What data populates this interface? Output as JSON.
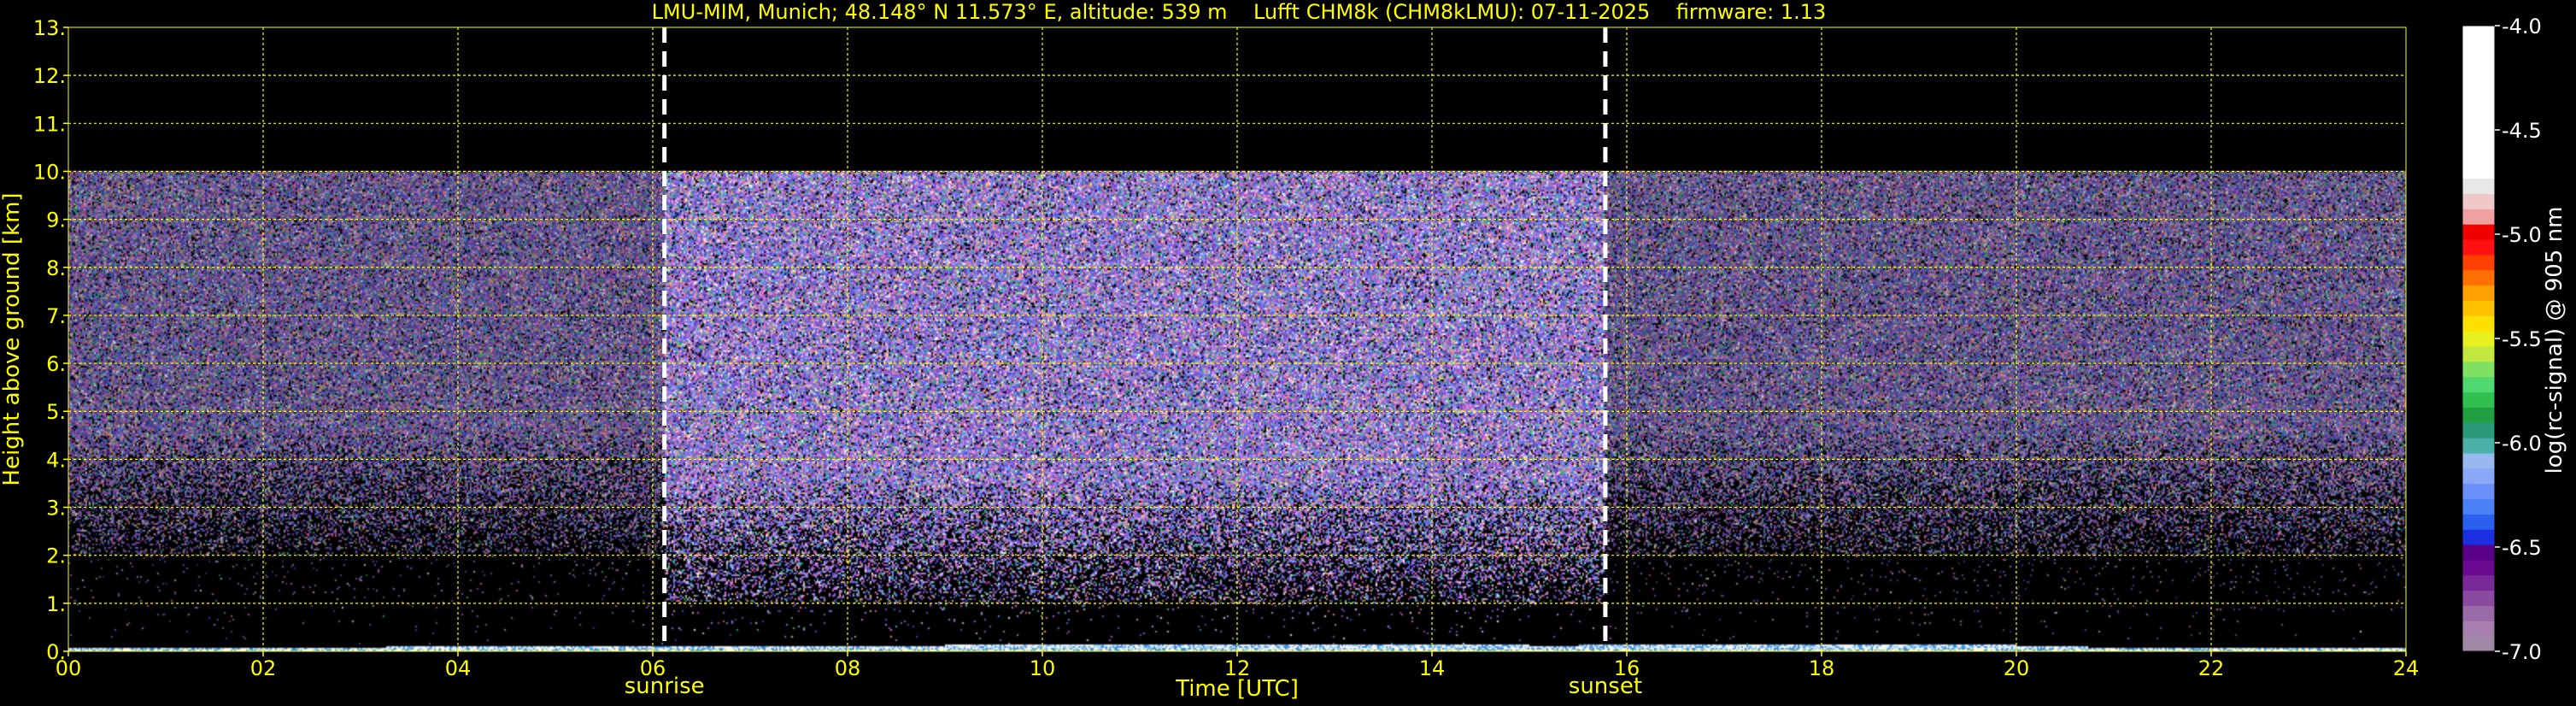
{
  "chart_data": {
    "type": "heatmap",
    "title": "LMU-MIM, Munich; 48.148° N 11.573° E, altitude: 539 m    Lufft CHM8k (CHM8kLMU): 07-11-2025    firmware: 1.13",
    "xlabel": "Time [UTC]",
    "ylabel": "Height above ground [km]",
    "xlim": [
      0,
      24
    ],
    "ylim": [
      0,
      13
    ],
    "x_ticks": [
      "00",
      "02",
      "04",
      "06",
      "08",
      "10",
      "12",
      "14",
      "16",
      "18",
      "20",
      "22",
      "24"
    ],
    "y_ticks": [
      "0.",
      "1.",
      "2.",
      "3.",
      "4.",
      "5.",
      "6.",
      "7.",
      "8.",
      "9.",
      "10.",
      "11.",
      "12.",
      "13."
    ],
    "grid": true,
    "signal_top_km": 10.0,
    "markers": [
      {
        "label": "sunrise",
        "x": 6.12
      },
      {
        "label": "sunset",
        "x": 15.78
      }
    ],
    "colorbar": {
      "label": "log(rc-signal) @ 905 nm",
      "ticks": [
        "-4.0",
        "-4.5",
        "-5.0",
        "-5.5",
        "-6.0",
        "-6.5",
        "-7.0"
      ],
      "range": [
        -7.0,
        -4.0
      ],
      "colors": [
        "#a08aa8",
        "#a880b0",
        "#9a6aa8",
        "#8a4aa0",
        "#7a2a98",
        "#6a0a90",
        "#5a0088",
        "#1a30e0",
        "#2a60f0",
        "#4a80f5",
        "#6a90f8",
        "#8aa8f8",
        "#9ab8f0",
        "#4ab0a8",
        "#2a9a7a",
        "#20a040",
        "#30c050",
        "#50d870",
        "#80e060",
        "#c0e840",
        "#e8f020",
        "#ffe000",
        "#ffc000",
        "#ffa000",
        "#ff7000",
        "#ff4000",
        "#ff1010",
        "#f00000",
        "#f0a0a0",
        "#f0c8c8",
        "#e8e8e8",
        "#ffffff",
        "#ffffff",
        "#ffffff",
        "#ffffff",
        "#ffffff",
        "#ffffff",
        "#ffffff",
        "#ffffff",
        "#ffffff",
        "#ffffff"
      ]
    }
  },
  "colors": {
    "text": "#ffff00",
    "grid": "#ffff00",
    "background": "#000000",
    "marker": "#ffffff",
    "colorbar_text": "#ffffff"
  }
}
